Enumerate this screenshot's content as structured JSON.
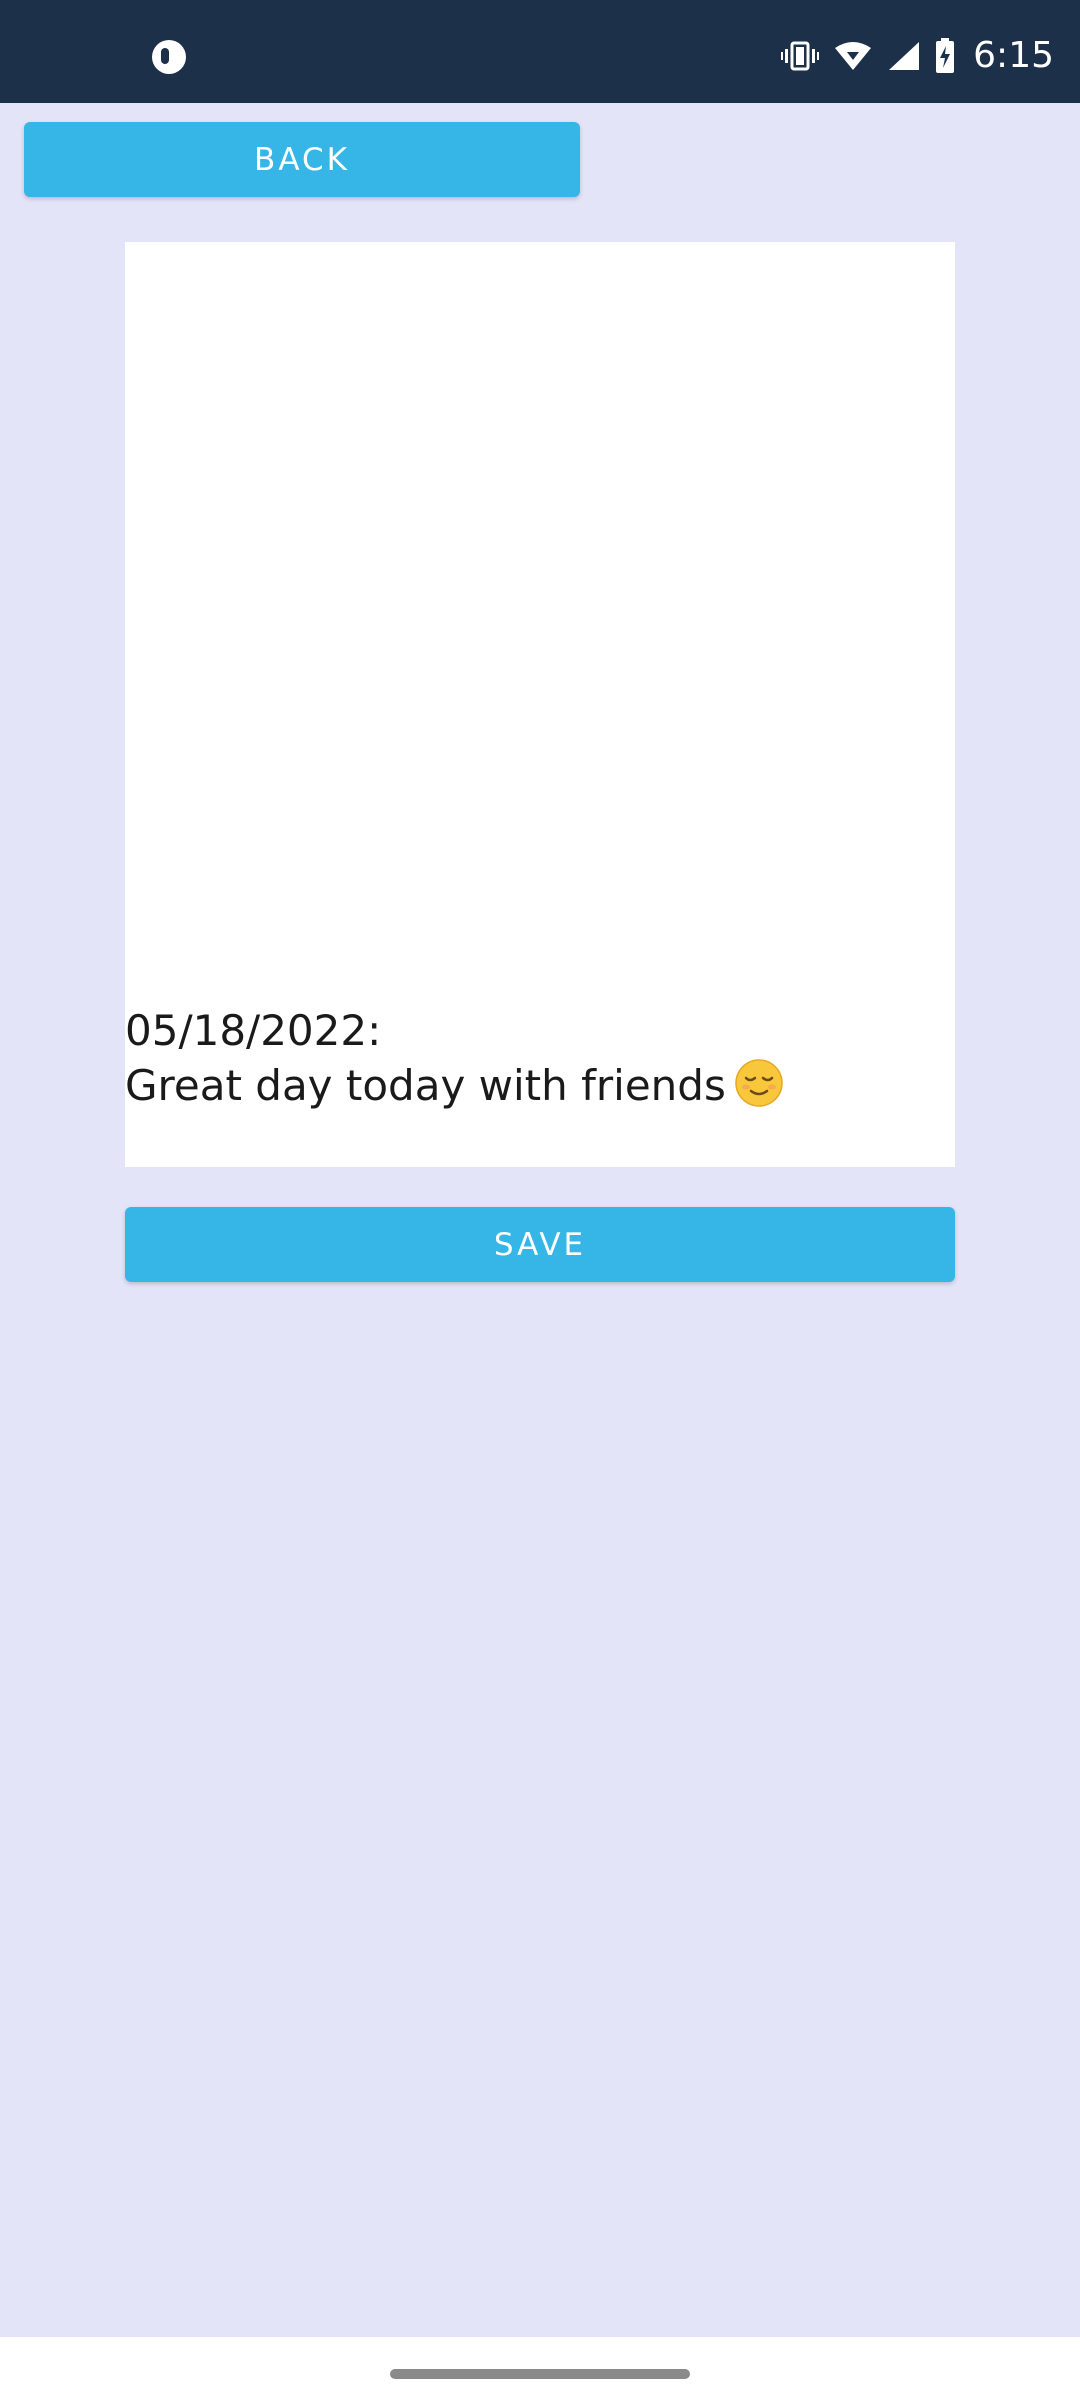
{
  "status_bar": {
    "time": "6:15",
    "background": "#1c3049",
    "icons": [
      "app-notification-icon",
      "vibrate-icon",
      "wifi-icon",
      "signal-icon",
      "battery-charging-icon"
    ]
  },
  "toolbar": {
    "back_label": "BACK"
  },
  "note": {
    "date": "05/18/2022:",
    "body": "Great day today with friends",
    "emoji_icon": "relieved-face-icon"
  },
  "actions": {
    "save_label": "SAVE"
  },
  "colors": {
    "accent": "#35b6e6",
    "background": "#e3e4f8",
    "card": "#ffffff"
  }
}
